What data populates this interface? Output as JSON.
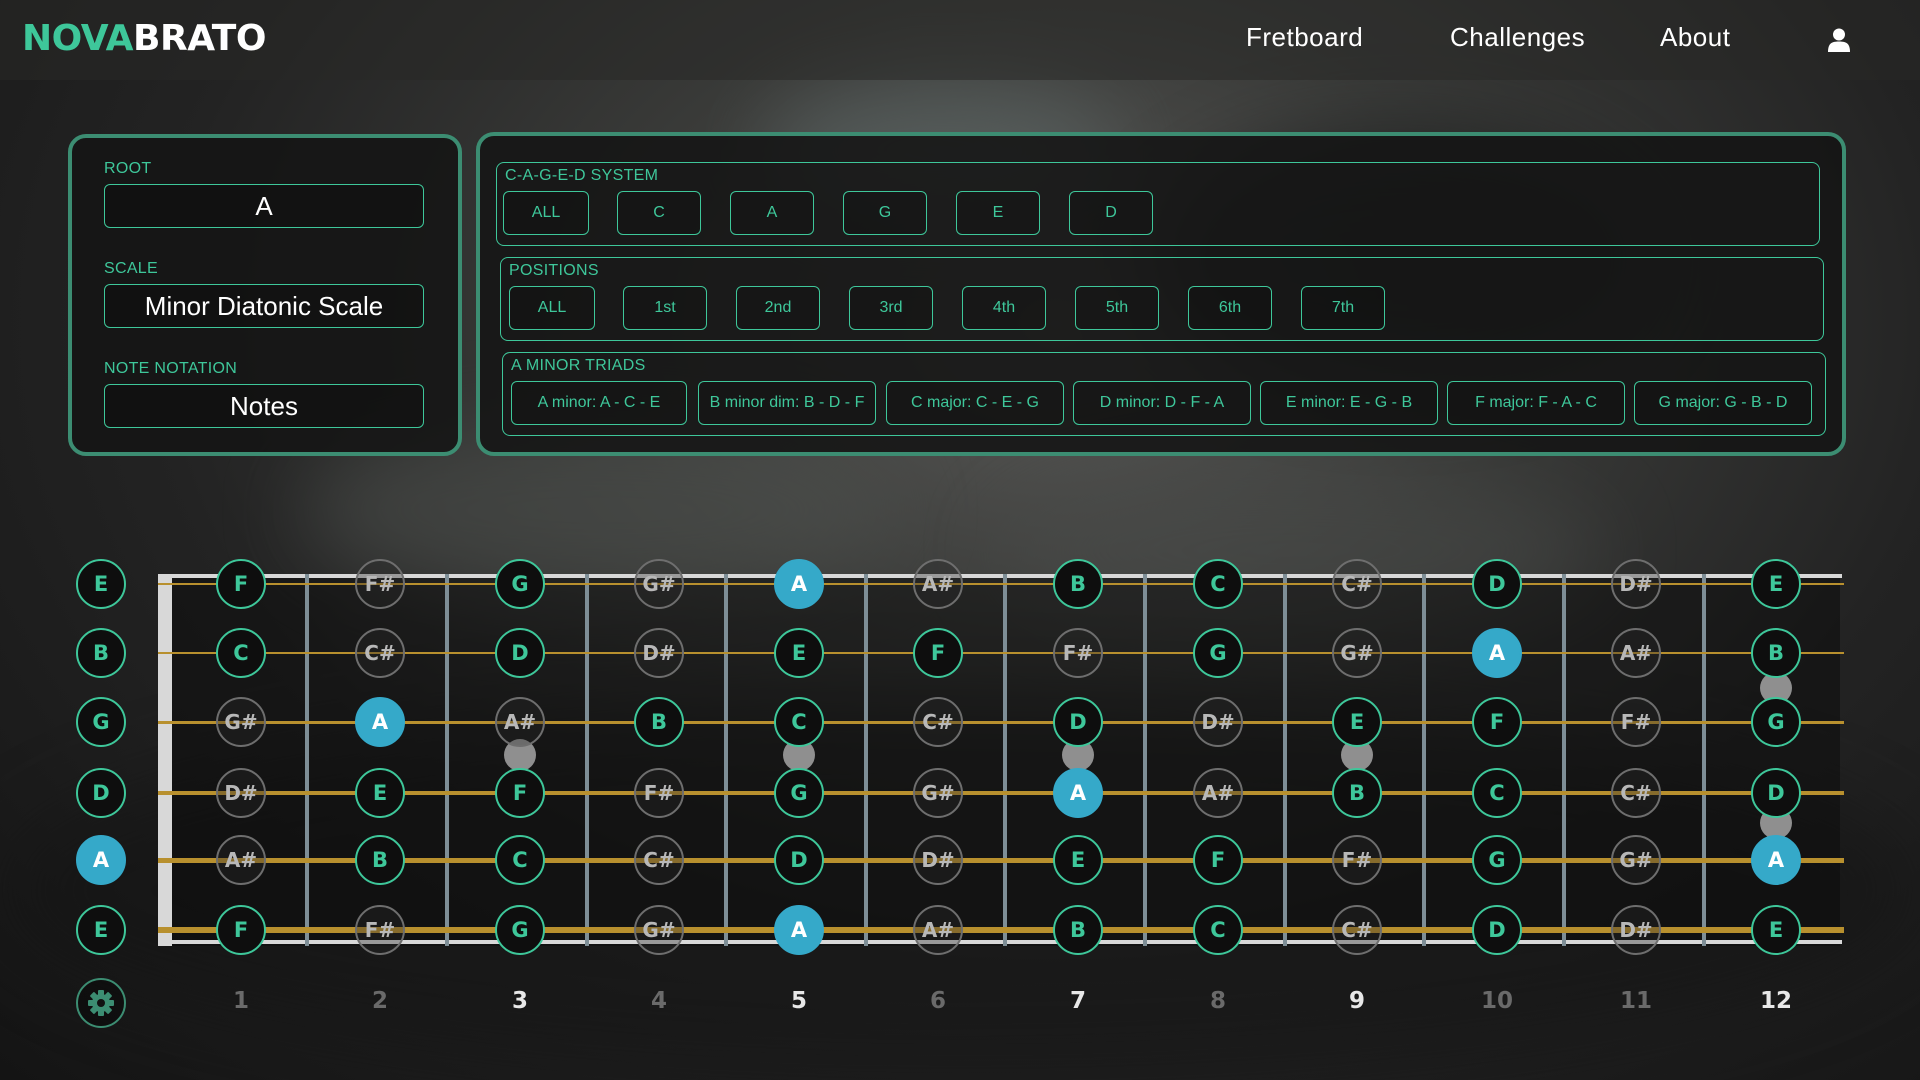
{
  "nav": {
    "logo_part1": "NOVA",
    "logo_part2": "BRATO",
    "links": [
      "Fretboard",
      "Challenges",
      "About"
    ],
    "user_icon": "user-icon"
  },
  "settings": {
    "root_label": "ROOT",
    "root_value": "A",
    "scale_label": "SCALE",
    "scale_value": "Minor Diatonic Scale",
    "notation_label": "NOTE NOTATION",
    "notation_value": "Notes"
  },
  "caged": {
    "title": "C-A-G-E-D SYSTEM",
    "buttons": [
      "ALL",
      "C",
      "A",
      "G",
      "E",
      "D"
    ]
  },
  "positions": {
    "title": "POSITIONS",
    "buttons": [
      "ALL",
      "1st",
      "2nd",
      "3rd",
      "4th",
      "5th",
      "6th",
      "7th"
    ]
  },
  "triads": {
    "title": "A MINOR TRIADS",
    "buttons": [
      "A minor: A - C - E",
      "B minor dim: B - D - F",
      "C major: C - E - G",
      "D minor: D - F - A",
      "E minor: E - G - B",
      "F major: F - A - C",
      "G major: G - B - D"
    ]
  },
  "fretboard": {
    "root_note": "A",
    "strings": [
      [
        "E",
        "F",
        "F#",
        "G",
        "G#",
        "A",
        "A#",
        "B",
        "C",
        "C#",
        "D",
        "D#",
        "E"
      ],
      [
        "B",
        "C",
        "C#",
        "D",
        "D#",
        "E",
        "F",
        "F#",
        "G",
        "G#",
        "A",
        "A#",
        "B"
      ],
      [
        "G",
        "G#",
        "A",
        "A#",
        "B",
        "C",
        "C#",
        "D",
        "D#",
        "E",
        "F",
        "F#",
        "G"
      ],
      [
        "D",
        "D#",
        "E",
        "F",
        "F#",
        "G",
        "G#",
        "A",
        "A#",
        "B",
        "C",
        "C#",
        "D"
      ],
      [
        "A",
        "A#",
        "B",
        "C",
        "C#",
        "D",
        "D#",
        "E",
        "F",
        "F#",
        "G",
        "G#",
        "A"
      ],
      [
        "E",
        "F",
        "F#",
        "G",
        "G#",
        "A",
        "A#",
        "B",
        "C",
        "C#",
        "D",
        "D#",
        "E"
      ]
    ],
    "fret_numbers": [
      "1",
      "2",
      "3",
      "4",
      "5",
      "6",
      "7",
      "8",
      "9",
      "10",
      "11",
      "12"
    ],
    "marked_frets": [
      "3",
      "5",
      "7",
      "9",
      "12"
    ],
    "settings_icon": "gear-icon"
  },
  "colors": {
    "accent": "#3ec79a",
    "panel_border": "#3c8d72",
    "root_note": "#35a9c9",
    "string": "#b8902e"
  }
}
